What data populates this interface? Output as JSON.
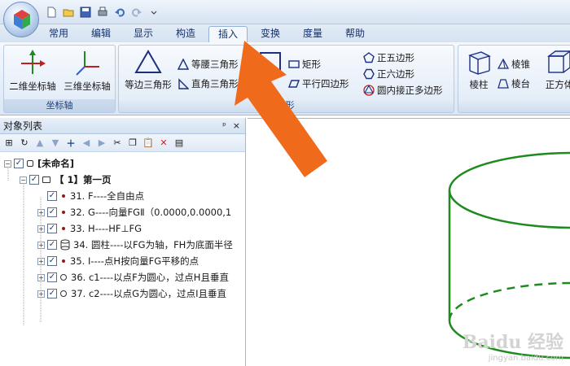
{
  "menu": {
    "tabs": [
      {
        "label": "常用"
      },
      {
        "label": "编辑"
      },
      {
        "label": "显示"
      },
      {
        "label": "构造"
      },
      {
        "label": "插入"
      },
      {
        "label": "变换"
      },
      {
        "label": "度量"
      },
      {
        "label": "帮助"
      }
    ],
    "active": "插入"
  },
  "ribbon": {
    "axis_group": {
      "label": "坐标轴",
      "buttons": [
        "二维坐标轴",
        "三维坐标轴"
      ]
    },
    "shape_group": {
      "label": "形",
      "equilateral_triangle": "等边三角形",
      "isosceles_triangle": "等腰三角形",
      "right_triangle": "直角三角形",
      "rectangle": "矩形",
      "parallelogram": "平行四边形",
      "pentagon": "正五边形",
      "hexagon": "正六边形",
      "inscribed_polygon": "圆内接正多边形"
    },
    "solid_group": {
      "prism": "棱柱",
      "pyramid": "棱锥",
      "frustum": "棱台",
      "cube": "正方体"
    }
  },
  "object_panel": {
    "title": "对象列表",
    "pin_glyph": "ᵖ",
    "close_glyph": "×",
    "root": "[未命名]",
    "page": "【 1】第一页",
    "items": [
      {
        "text": "31. F----全自由点",
        "icon": "point"
      },
      {
        "text": "32. G----向量FGⅡ（0.0000,0.0000,1",
        "icon": "point"
      },
      {
        "text": "33. H----HF⊥FG",
        "icon": "point"
      },
      {
        "text": "34. 圆柱----以FG为轴，FH为底面半径",
        "icon": "cylinder"
      },
      {
        "text": "35. I----点H按向量FG平移的点",
        "icon": "point"
      },
      {
        "text": "36. c1----以点F为圆心，过点H且垂直",
        "icon": "circle"
      },
      {
        "text": "37. c2----以点G为圆心，过点I且垂直",
        "icon": "circle"
      }
    ]
  },
  "watermark": {
    "main": "Baidu 经验",
    "url": "jingyan.baidu.com"
  },
  "colors": {
    "accent_arrow": "#f06a1c",
    "cylinder": "#1f8a1f"
  }
}
